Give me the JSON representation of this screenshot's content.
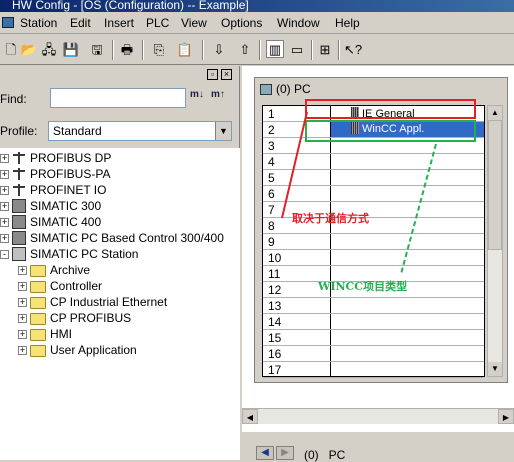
{
  "window": {
    "title": "HW Config - [OS (Configuration) -- Example]"
  },
  "menu": [
    "Station",
    "Edit",
    "Insert",
    "PLC",
    "View",
    "Options",
    "Window",
    "Help"
  ],
  "toolbar": {
    "icons": [
      "new-icon",
      "open-icon",
      "network-icon",
      "save-icon",
      "save-compile-icon",
      "print-icon",
      "copy-icon",
      "paste-icon",
      "download-icon",
      "upload-icon",
      "catalog-icon",
      "module-info-icon",
      "netpro-icon",
      "whats-this-icon"
    ]
  },
  "catalog": {
    "find_label": "Find:",
    "find_value": "",
    "profile_label": "Profile:",
    "profile_value": "Standard",
    "tree": [
      {
        "label": "PROFIBUS DP",
        "icon": "profibus-icon",
        "level": 0,
        "expander": "+"
      },
      {
        "label": "PROFIBUS-PA",
        "icon": "profibus-icon",
        "level": 0,
        "expander": "+"
      },
      {
        "label": "PROFINET IO",
        "icon": "profinet-icon",
        "level": 0,
        "expander": "+"
      },
      {
        "label": "SIMATIC 300",
        "icon": "rack-icon",
        "level": 0,
        "expander": "+"
      },
      {
        "label": "SIMATIC 400",
        "icon": "rack-icon",
        "level": 0,
        "expander": "+"
      },
      {
        "label": "SIMATIC PC Based Control 300/400",
        "icon": "rack-icon",
        "level": 0,
        "expander": "+"
      },
      {
        "label": "SIMATIC PC Station",
        "icon": "pc-station-icon",
        "level": 0,
        "expander": "-"
      },
      {
        "label": "Archive",
        "icon": "folder-icon",
        "level": 1,
        "expander": "+"
      },
      {
        "label": "Controller",
        "icon": "folder-icon",
        "level": 1,
        "expander": "+"
      },
      {
        "label": "CP Industrial Ethernet",
        "icon": "folder-icon",
        "level": 1,
        "expander": "+"
      },
      {
        "label": "CP PROFIBUS",
        "icon": "folder-icon",
        "level": 1,
        "expander": "+"
      },
      {
        "label": "HMI",
        "icon": "folder-icon",
        "level": 1,
        "expander": "+"
      },
      {
        "label": "User Application",
        "icon": "folder-icon",
        "level": 1,
        "expander": "+"
      }
    ]
  },
  "station": {
    "title": "(0) PC",
    "slots": [
      {
        "index": "1",
        "module": "IE General",
        "selected": false
      },
      {
        "index": "2",
        "module": "WinCC Appl.",
        "selected": true
      },
      {
        "index": "3",
        "module": ""
      },
      {
        "index": "4",
        "module": ""
      },
      {
        "index": "5",
        "module": ""
      },
      {
        "index": "6",
        "module": ""
      },
      {
        "index": "7",
        "module": ""
      },
      {
        "index": "8",
        "module": ""
      },
      {
        "index": "9",
        "module": ""
      },
      {
        "index": "10",
        "module": ""
      },
      {
        "index": "11",
        "module": ""
      },
      {
        "index": "12",
        "module": ""
      },
      {
        "index": "13",
        "module": ""
      },
      {
        "index": "14",
        "module": ""
      },
      {
        "index": "15",
        "module": ""
      },
      {
        "index": "16",
        "module": ""
      },
      {
        "index": "17",
        "module": ""
      }
    ]
  },
  "bottom": {
    "station_label": "(0)   PC"
  },
  "annotations": {
    "red_text": "取决于通信方式",
    "green_text": "WINCC项目类型",
    "red_color": "#e31f26",
    "green_color": "#22b14c"
  }
}
